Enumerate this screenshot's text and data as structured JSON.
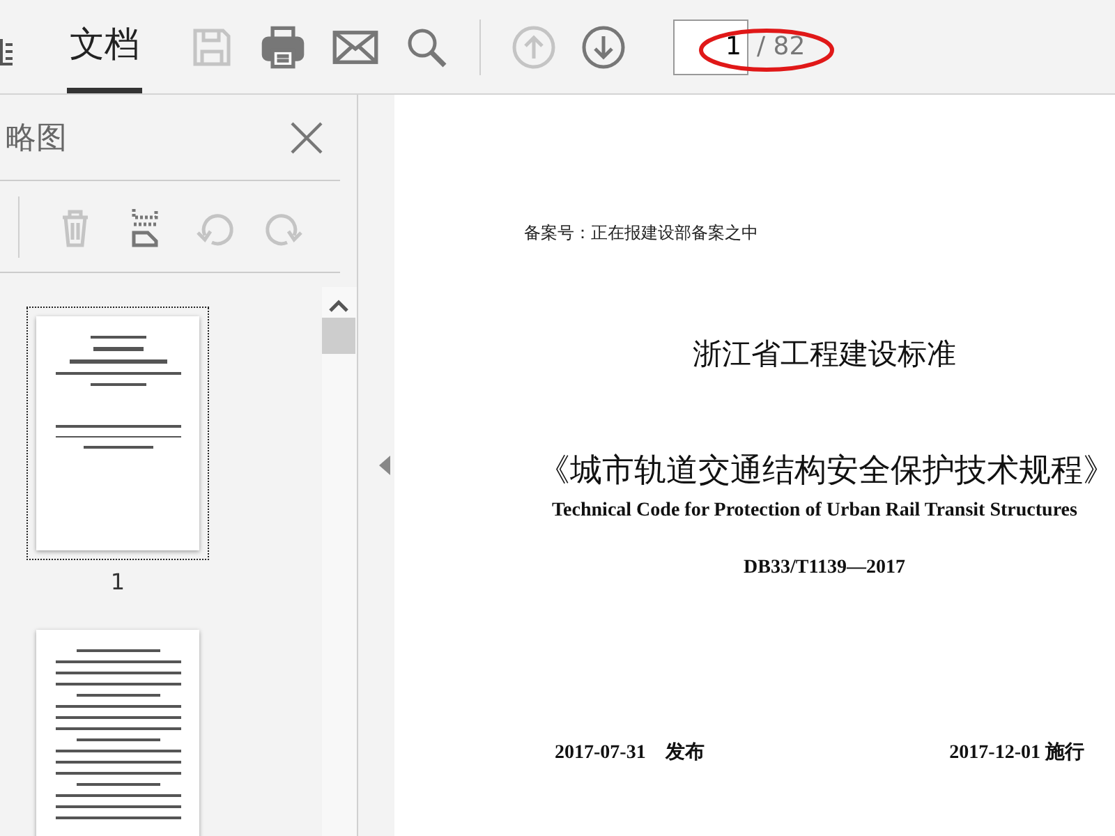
{
  "tabs": [
    {
      "label": "文档",
      "selected": true
    }
  ],
  "toolbar": {
    "save_disabled": true,
    "page_up_disabled": true,
    "page_down_disabled": false,
    "page_input": "1",
    "page_total": "/ 82"
  },
  "sidebar": {
    "title": "略图",
    "tools": [
      {
        "kind": "delete",
        "disabled": true
      },
      {
        "kind": "extract",
        "disabled": false
      },
      {
        "kind": "rotate-left",
        "disabled": true
      },
      {
        "kind": "rotate-right",
        "disabled": true
      }
    ],
    "thumbnails": [
      {
        "label": "1",
        "selected": true
      },
      {
        "selected": false
      }
    ]
  },
  "document": {
    "record_no": "备案号：正在报建设部备案之中",
    "standard": "浙江省工程建设标准",
    "title": "《城市轨道交通结构安全保护技术规程》",
    "english_title": "Technical Code for Protection of Urban Rail Transit Structures",
    "code": "DB33/T1139—2017",
    "issued": "2017-07-31　发布",
    "effective": "2017-12-01 施行"
  }
}
